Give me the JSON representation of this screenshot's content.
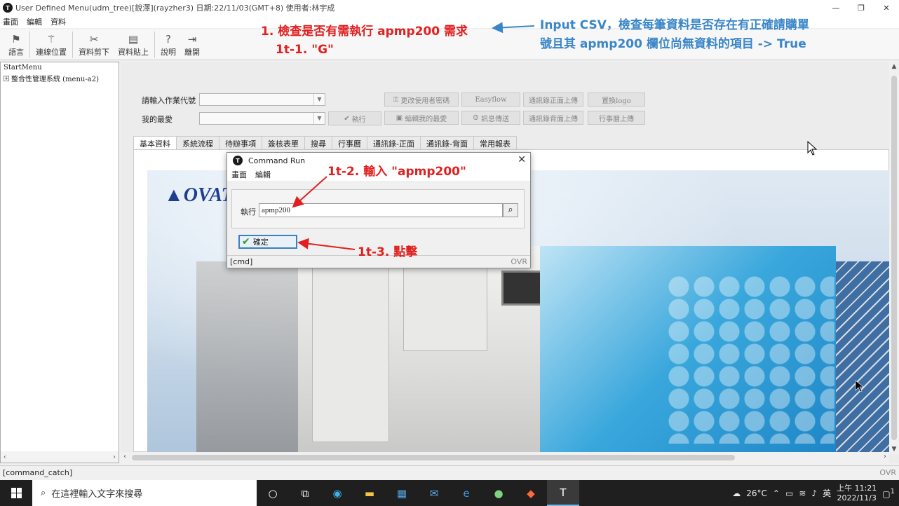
{
  "window": {
    "title": "User Defined Menu(udm_tree)[銳澤](rayzher3) 日期:22/11/03(GMT+8) 使用者:林宇成",
    "controls": [
      "—",
      "❐",
      "✕"
    ]
  },
  "menubar": [
    "畫面",
    "編輯",
    "資料"
  ],
  "toolbar": [
    {
      "label": "語言",
      "icon": "flag-icon"
    },
    {
      "label": "連線位置",
      "icon": "wand-icon"
    },
    {
      "label": "資料剪下",
      "icon": "scissors-icon"
    },
    {
      "label": "資料貼上",
      "icon": "paste-icon"
    },
    {
      "label": "說明",
      "icon": "help-icon"
    },
    {
      "label": "離開",
      "icon": "exit-icon"
    }
  ],
  "tree": {
    "root": "StartMenu",
    "items": [
      "整合性管理系統 (menu-a2)"
    ]
  },
  "form": {
    "job_code_label": "請輸入作業代號",
    "favorites_label": "我的最愛",
    "execute_label": "執行",
    "buttons_row1": [
      "更改使用者密碼",
      "Easyflow",
      "通訊錄正面上傳",
      "置換logo"
    ],
    "buttons_row2": [
      "編輯我的最愛",
      "訊息傳送",
      "通訊錄背面上傳",
      "行事曆上傳"
    ]
  },
  "tabs": [
    "基本資料",
    "系統流程",
    "待辦事項",
    "簽核表單",
    "搜尋",
    "行事曆",
    "通訊錄-正面",
    "通訊錄-背面",
    "常用報表"
  ],
  "banner": {
    "logo_text": "OVAT"
  },
  "dialog": {
    "title": "Command Run",
    "menu": [
      "畫面",
      "編輯"
    ],
    "exec_label": "執行",
    "input_value": "apmp200",
    "ok_label": "確定",
    "status": "[cmd]",
    "ovr": "OVR"
  },
  "statusbar": {
    "text": "[command_catch]",
    "ovr": "OVR"
  },
  "taskbar": {
    "search_placeholder": "在這裡輸入文字來搜尋",
    "weather": "26°C",
    "ime": "英",
    "time": "上午 11:21",
    "date": "2022/11/3",
    "notification_count": "1"
  },
  "annotations": {
    "step1": "1. 檢查是否有需執行 apmp200 需求",
    "step1t1": "1t-1. \"G\"",
    "step1t2": "1t-2. 輸入 \"apmp200\"",
    "step1t3": "1t-3. 點擊",
    "csv_line1": "Input CSV，檢查每筆資料是否存在有正確請購單",
    "csv_line2": "號且其 apmp200 欄位尚無資料的項目 -> True"
  },
  "colors": {
    "annotation_red": "#e02020",
    "annotation_blue": "#3a86c8",
    "focus_border": "#3b7fc4"
  }
}
